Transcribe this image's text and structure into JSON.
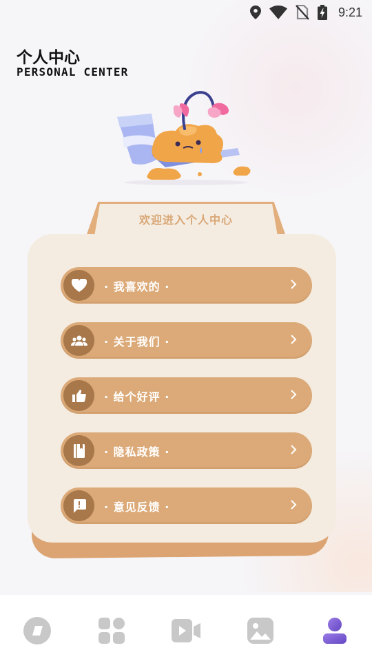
{
  "status_bar": {
    "time": "9:21",
    "icons": [
      "location-icon",
      "wifi-icon",
      "no-sim-icon",
      "battery-charging-icon"
    ]
  },
  "header": {
    "title": "个人中心",
    "subtitle": "PERSONAL CENTER"
  },
  "card": {
    "welcome": "欢迎进入个人中心",
    "items": [
      {
        "label": "· 我喜欢的 ·",
        "icon": "heart-icon"
      },
      {
        "label": "· 关于我们 ·",
        "icon": "group-icon"
      },
      {
        "label": "· 给个好评 ·",
        "icon": "thumbs-up-icon"
      },
      {
        "label": "· 隐私政策 ·",
        "icon": "notebook-icon"
      },
      {
        "label": "· 意见反馈 ·",
        "icon": "feedback-icon"
      }
    ]
  },
  "bottom_nav": {
    "items": [
      "home-icon",
      "apps-grid-icon",
      "video-icon",
      "gallery-icon",
      "profile-icon"
    ],
    "active_index": 4
  },
  "colors": {
    "button_bg": "#dcaa78",
    "icon_circle": "#a8784a",
    "card_bg": "#f4ece1",
    "card_edge": "#dba472",
    "nav_active": "#7b5ccf",
    "nav_inactive": "#c8c8c8"
  }
}
